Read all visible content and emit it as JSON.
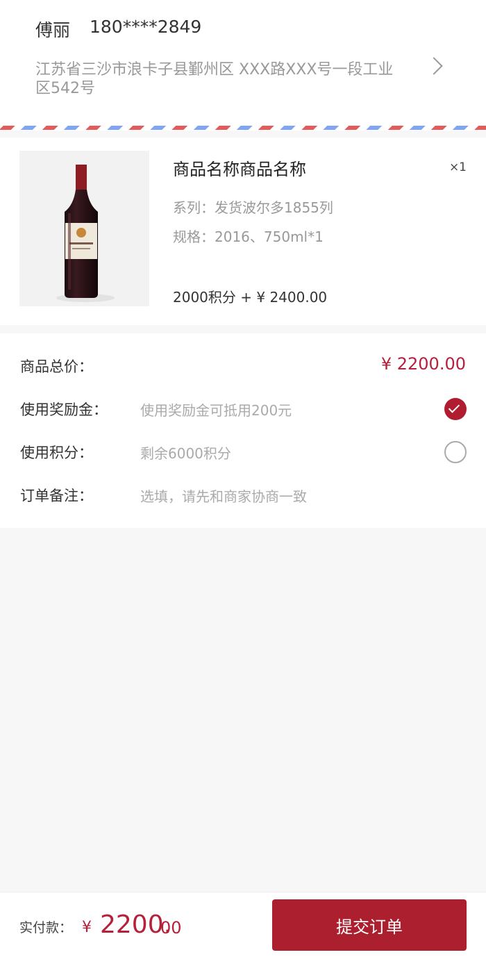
{
  "address": {
    "name": "傅丽",
    "phone": "180****2849",
    "detail": "江苏省三沙市浪卡子县鄞州区 XXX路XXX号一段工业区542号"
  },
  "product": {
    "name": "商品名称商品名称",
    "quantity": "×1",
    "series": "系列：发货波尔多1855列",
    "spec": "规格：2016、750ml*1",
    "price": "2000积分 + ¥ 2400.00",
    "image_icon": "wine-bottle"
  },
  "summary": {
    "total_label": "商品总价：",
    "total_value": "¥ 2200.00",
    "bonus_label": "使用奖励金：",
    "bonus_value": "使用奖励金可抵用200元",
    "bonus_checked": true,
    "points_label": "使用积分：",
    "points_value": "剩余6000积分",
    "points_checked": false,
    "note_label": "订单备注：",
    "note_placeholder": "选填，请先和商家协商一致"
  },
  "footer": {
    "pay_label": "实付款：",
    "currency": "¥",
    "amount_int": "2200.",
    "amount_dec": "00",
    "submit_label": "提交订单"
  },
  "colors": {
    "accent": "#ac1f2f",
    "airmail_red": "#e45b5b",
    "airmail_blue": "#7fa5f4"
  }
}
